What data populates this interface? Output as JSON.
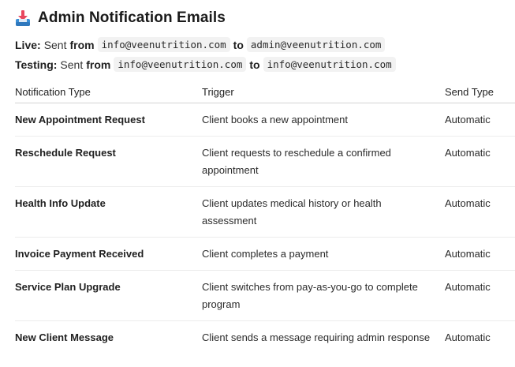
{
  "header": {
    "title": "Admin Notification Emails",
    "icon": "inbox-tray-icon"
  },
  "environments": {
    "live": {
      "label": "Live:",
      "sent": "Sent",
      "from_word": "from",
      "from_address": "info@veenutrition.com",
      "to_word": "to",
      "to_address": "admin@veenutrition.com"
    },
    "testing": {
      "label": "Testing:",
      "sent": "Sent",
      "from_word": "from",
      "from_address": "info@veenutrition.com",
      "to_word": "to",
      "to_address": "info@veenutrition.com"
    }
  },
  "table": {
    "headers": [
      "Notification Type",
      "Trigger",
      "Send Type"
    ],
    "rows": [
      {
        "type": "New Appointment Request",
        "trigger": "Client books a new appointment",
        "send": "Automatic"
      },
      {
        "type": "Reschedule Request",
        "trigger": "Client requests to reschedule a confirmed appointment",
        "send": "Automatic"
      },
      {
        "type": "Health Info Update",
        "trigger": "Client updates medical history or health assessment",
        "send": "Automatic"
      },
      {
        "type": "Invoice Payment Received",
        "trigger": "Client completes a payment",
        "send": "Automatic"
      },
      {
        "type": "Service Plan Upgrade",
        "trigger": "Client switches from pay-as-you-go to complete program",
        "send": "Automatic"
      },
      {
        "type": "New Client Message",
        "trigger": "Client sends a message requiring admin response",
        "send": "Automatic"
      }
    ]
  },
  "colors": {
    "icon_tray": "#3b8fd6",
    "icon_arrow": "#e8475f"
  }
}
